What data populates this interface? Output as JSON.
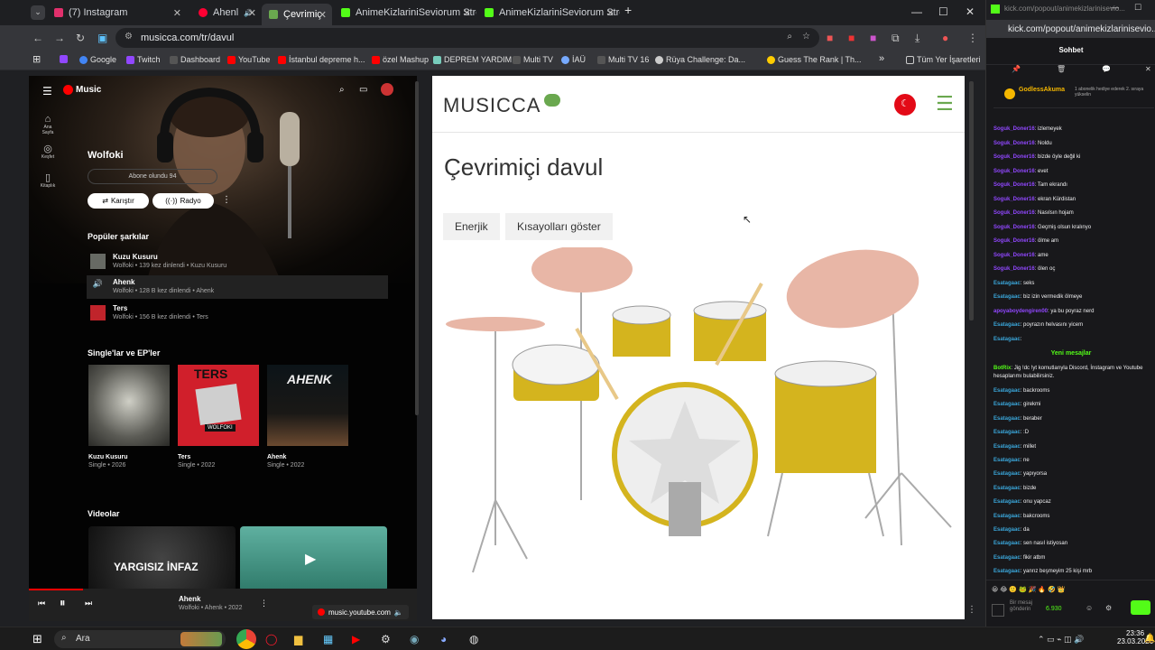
{
  "browser": {
    "tabs": [
      {
        "label": "(7) Instagram",
        "color": "#e1306c"
      },
      {
        "label": "Ahenl",
        "color": "#ff0033"
      },
      {
        "label": "Çevrimiç",
        "color": "#6aa84f"
      },
      {
        "label": "AnimeKizlariniSeviorum Stream",
        "color": "#53fc18"
      },
      {
        "label": "AnimeKizlariniSeviorum Stream",
        "color": "#53fc18"
      }
    ],
    "url": "musicca.com/tr/davul",
    "bookmarks": [
      "Google",
      "Twitch",
      "Dashboard",
      "YouTube",
      "İstanbul depreme h...",
      "özel Mashup",
      "DEPREM YARDIM",
      "Multi TV",
      "İAÜ",
      "Multi TV 16",
      "Rüya Challenge: Da...",
      "Guess The Rank | Th...",
      "Tüm Yer İşaretleri"
    ]
  },
  "ytmusic": {
    "logo": "Music",
    "nav": [
      {
        "icon": "home-icon",
        "label": "Ana Sayfa"
      },
      {
        "icon": "compass-icon",
        "label": "Keşfet"
      },
      {
        "icon": "library-icon",
        "label": "Kitaplık"
      }
    ],
    "artist": "Wolfoki",
    "subscribed": "Abone olundu 94",
    "shuffle": "Karıştır",
    "radio": "Radyo",
    "popular_title": "Popüler şarkılar",
    "songs": [
      {
        "title": "Kuzu Kusuru",
        "sub": "Wolfoki • 139 kez dinlendi • Kuzu Kusuru"
      },
      {
        "title": "Ahenk",
        "sub": "Wolfoki • 128 B kez dinlendi • Ahenk"
      },
      {
        "title": "Ters",
        "sub": "Wolfoki • 156 B kez dinlendi • Ters"
      }
    ],
    "singles_title": "Single'lar ve EP'ler",
    "singles": [
      {
        "title": "Kuzu Kusuru",
        "sub": "Single • 2026"
      },
      {
        "title": "Ters",
        "sub": "Single • 2022"
      },
      {
        "title": "Ahenk",
        "sub": "Single • 2022"
      }
    ],
    "cover_text": [
      "TERS",
      "AHENK",
      "WOLFOKI"
    ],
    "videos_title": "Videolar",
    "video_caption": "YARGISIZ İNFAZ",
    "player": {
      "title": "Ahenk",
      "sub": "Wolfoki • Ahenk • 2022",
      "tab": "music.youtube.com"
    }
  },
  "musicca": {
    "logo": "MUSICCA",
    "title": "Çevrimiçi davul",
    "btn_energy": "Enerjik",
    "btn_shortcuts": "Kısayolları göster"
  },
  "chat": {
    "url": "kick.com/popout/animekizlarinisevio...",
    "header": "Sohbet",
    "pinned_user": "GodlessAkuma",
    "pinned_text": "1 abonelik hediye ederek 2. sıraya yükselin",
    "messages": [
      {
        "user": "Soguk_Doner16",
        "text": "izlemeyek"
      },
      {
        "user": "Soguk_Doner16",
        "text": "Noldu"
      },
      {
        "user": "Soguk_Doner16",
        "text": "bizde öyle değil ki"
      },
      {
        "user": "Soguk_Doner16",
        "text": "evet"
      },
      {
        "user": "Soguk_Doner16",
        "text": "Tam ekrandı"
      },
      {
        "user": "Soguk_Doner16",
        "text": "ekran Kürdistan"
      },
      {
        "user": "Soguk_Doner16",
        "text": "Nasılsın hojam"
      },
      {
        "user": "Soguk_Doner16",
        "text": "Geçmiş olsun kralınyo"
      },
      {
        "user": "Soguk_Doner16",
        "text": "ölme am"
      },
      {
        "user": "Soguk_Doner16",
        "text": "ame"
      },
      {
        "user": "Soguk_Doner16",
        "text": "ölen oç"
      },
      {
        "user": "Esatagaac",
        "text": "seks"
      },
      {
        "user": "Esatagaac",
        "text": "biz izin vermedik ölmeye"
      },
      {
        "user": "apoyaboydengiren00",
        "text": "ya bu poyraz nerd"
      },
      {
        "user": "Esatagaac",
        "text": "poyrazın helvasını yicem"
      },
      {
        "user": "Esatagaac",
        "text": ""
      }
    ],
    "new_label": "Yeni mesajlar",
    "bot_user": "BotRix",
    "bot_text": "Jig !dc !yt komutlarıyla Discord, İnstagram ve Youtube hesaplarımı bulabilirsiniz.",
    "messages2": [
      {
        "user": "Esatagaac",
        "text": "backrooms"
      },
      {
        "user": "Esatagaac",
        "text": "girekmi"
      },
      {
        "user": "Esatagaac",
        "text": "beraber"
      },
      {
        "user": "Esatagaac",
        "text": ":D"
      },
      {
        "user": "Esatagaac",
        "text": "millet"
      },
      {
        "user": "Esatagaac",
        "text": "ne"
      },
      {
        "user": "Esatagaac",
        "text": "yapıyorsa"
      },
      {
        "user": "Esatagaac",
        "text": "bizde"
      },
      {
        "user": "Esatagaac",
        "text": "onu yapcaz"
      },
      {
        "user": "Esatagaac",
        "text": "bakcrooms"
      },
      {
        "user": "Esatagaac",
        "text": "da"
      },
      {
        "user": "Esatagaac",
        "text": "sen nasıl istiyosan"
      },
      {
        "user": "Esatagaac",
        "text": "fikir atbm"
      },
      {
        "user": "Esatagaac",
        "text": "yanrız beşmeyim 25 kişi mrb"
      }
    ],
    "send_placeholder": "Bir mesaj gönderin",
    "points": "6.930"
  },
  "taskbar": {
    "search": "Ara",
    "time": "23:36",
    "date": "23.03.2026"
  }
}
